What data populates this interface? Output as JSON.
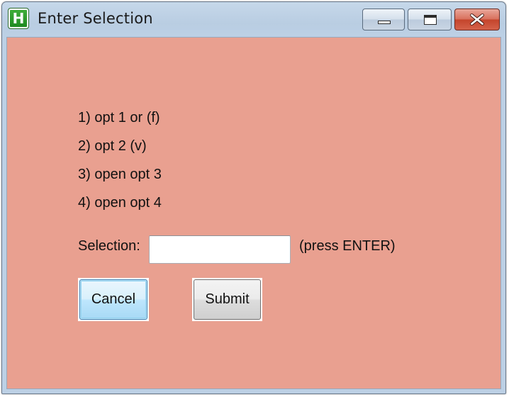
{
  "window": {
    "title": "Enter Selection",
    "app_icon_letter": "H",
    "client_background": "#e9a090"
  },
  "options": {
    "items": [
      {
        "label": "1) opt 1 or (f)"
      },
      {
        "label": "2) opt 2 (v)"
      },
      {
        "label": "3) open opt 3"
      },
      {
        "label": "4) open opt 4"
      }
    ]
  },
  "selection": {
    "label": "Selection:",
    "value": "",
    "placeholder": "",
    "hint": "(press ENTER)"
  },
  "buttons": {
    "cancel_label": "Cancel",
    "submit_label": "Submit"
  },
  "caption_buttons": {
    "minimize_icon": "minimize-icon",
    "maximize_icon": "maximize-icon",
    "close_icon": "close-icon"
  }
}
